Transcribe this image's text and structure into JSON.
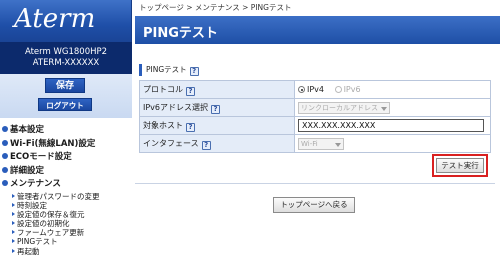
{
  "sidebar": {
    "logo": "Aterm",
    "model_line1": "Aterm WG1800HP2",
    "model_line2": "ATERM-XXXXXX",
    "save_label": "保存",
    "logout_label": "ログアウト",
    "menu": [
      {
        "label": "基本設定"
      },
      {
        "label": "Wi-Fi(無線LAN)設定"
      },
      {
        "label": "ECOモード設定"
      },
      {
        "label": "詳細設定"
      },
      {
        "label": "メンテナンス"
      }
    ],
    "maintenance_items": [
      {
        "label": "管理者パスワードの変更"
      },
      {
        "label": "時刻設定"
      },
      {
        "label": "設定値の保存＆復元"
      },
      {
        "label": "設定値の初期化"
      },
      {
        "label": "ファームウェア更新"
      },
      {
        "label": "PINGテスト"
      },
      {
        "label": "再起動"
      }
    ]
  },
  "breadcrumb": "トップページ > メンテナンス > PINGテスト",
  "page_title": "PINGテスト",
  "section": {
    "title": "PINGテスト",
    "help": "?"
  },
  "form": {
    "protocol_label": "プロトコル",
    "protocol_options": [
      "IPv4",
      "IPv6"
    ],
    "protocol_selected": "IPv4",
    "ipv6_select_label": "IPv6アドレス選択",
    "ipv6_select_value": "リンクローカルアドレス",
    "target_host_label": "対象ホスト",
    "target_host_value": "XXX.XXX.XXX.XXX",
    "interface_label": "インタフェース",
    "interface_value": "Wi-Fi"
  },
  "buttons": {
    "exec_label": "テスト実行",
    "back_label": "トップページへ戻る"
  },
  "colors": {
    "accent": "#2a5dbb",
    "highlight": "#d92020"
  }
}
